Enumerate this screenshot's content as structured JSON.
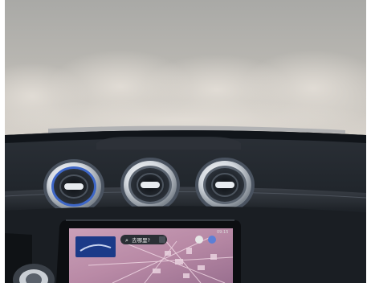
{
  "photo": {
    "subject": "car-dashboard-interior",
    "colors": {
      "windshield_top": "#ababa8",
      "windshield_mid": "#cfcac3",
      "dash_dark": "#1b2026",
      "vent_chrome": "#dfe4ea",
      "vent_accent": "#2f5fc4",
      "screen_map": "#b889a6"
    }
  },
  "screen": {
    "search_text": "去哪里?",
    "status_time": "09:15"
  }
}
